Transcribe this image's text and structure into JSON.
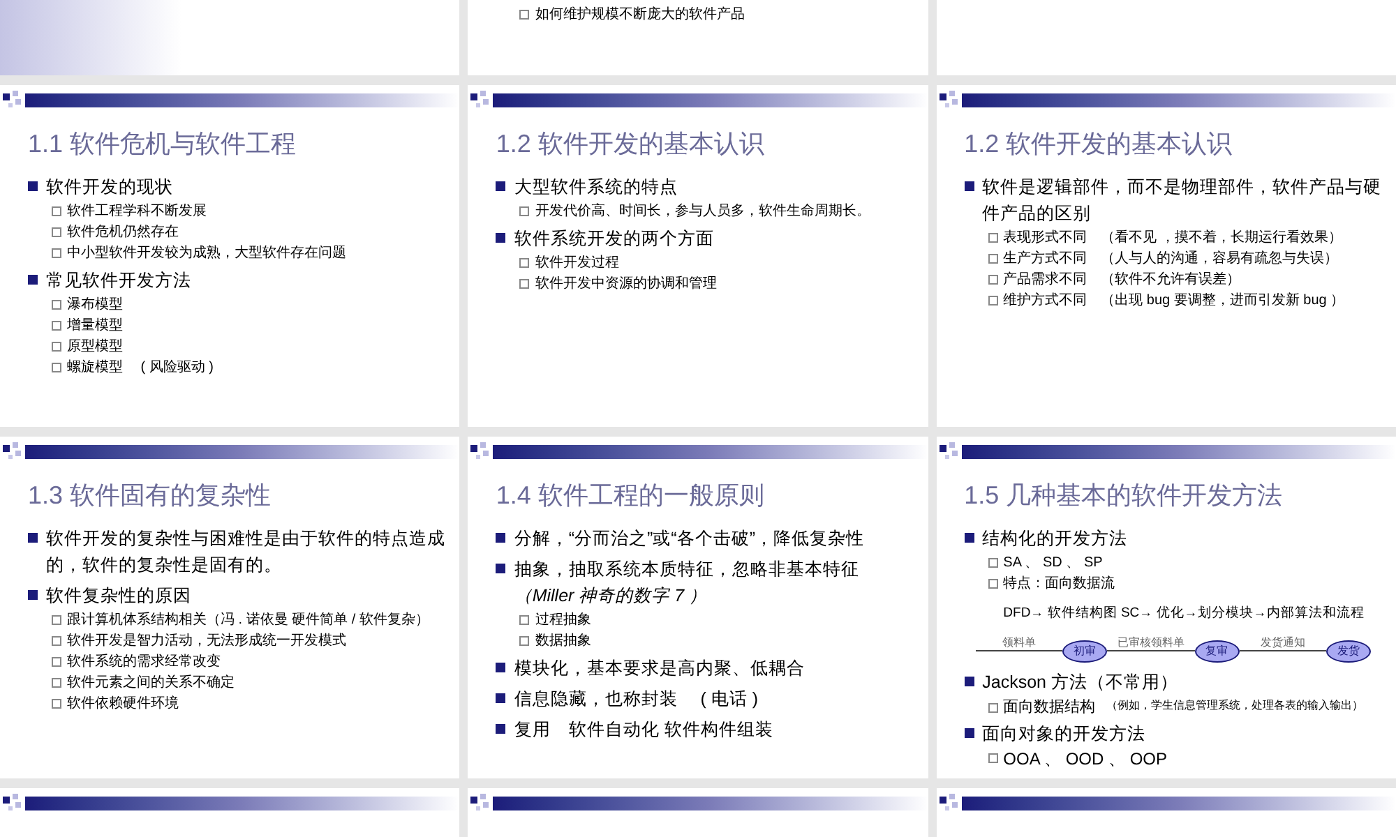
{
  "slides": [
    {
      "kind": "cut_top",
      "shaded": true
    },
    {
      "kind": "cut_top",
      "items": [
        {
          "kind": "sub",
          "text": "如何维护规模不断庞大的软件产品"
        }
      ]
    },
    {
      "kind": "cut_top"
    },
    {
      "kind": "full",
      "title": "1.1  软件危机与软件工程",
      "items": [
        {
          "kind": "bullet",
          "text": "软件开发的现状"
        },
        {
          "kind": "sub",
          "text": "软件工程学科不断发展"
        },
        {
          "kind": "sub",
          "text": "软件危机仍然存在"
        },
        {
          "kind": "sub",
          "text": "中小型软件开发较为成熟，大型软件存在问题"
        },
        {
          "kind": "bullet",
          "text": "常见软件开发方法"
        },
        {
          "kind": "sub",
          "text": "瀑布模型"
        },
        {
          "kind": "sub",
          "text": "增量模型"
        },
        {
          "kind": "sub",
          "text": "原型模型"
        },
        {
          "kind": "sub",
          "text": "螺旋模型　 ( 风险驱动 )"
        }
      ]
    },
    {
      "kind": "full",
      "title": "1.2  软件开发的基本认识",
      "items": [
        {
          "kind": "bullet",
          "text": "大型软件系统的特点"
        },
        {
          "kind": "sub",
          "text": "开发代价高、时间长，参与人员多，软件生命周期长。"
        },
        {
          "kind": "bullet",
          "text": "软件系统开发的两个方面"
        },
        {
          "kind": "sub",
          "text": "软件开发过程"
        },
        {
          "kind": "sub",
          "text": "软件开发中资源的协调和管理"
        }
      ]
    },
    {
      "kind": "full",
      "title": "1.2  软件开发的基本认识",
      "items": [
        {
          "kind": "bullet",
          "text": "软件是逻辑部件，而不是物理部件，软件产品与硬件产品的区别"
        },
        {
          "kind": "sub",
          "text": "表现形式不同　（看不见 ，摸不着，长期运行看效果）"
        },
        {
          "kind": "sub",
          "text": "生产方式不同　（人与人的沟通，容易有疏忽与失误）"
        },
        {
          "kind": "sub",
          "text": "产品需求不同　（软件不允许有误差）"
        },
        {
          "kind": "sub",
          "text": "维护方式不同　（出现 bug 要调整，进而引发新 bug ）"
        }
      ]
    },
    {
      "kind": "full",
      "title": "1.3  软件固有的复杂性",
      "items": [
        {
          "kind": "bullet",
          "text": "软件开发的复杂性与困难性是由于软件的特点造成的，软件的复杂性是固有的。"
        },
        {
          "kind": "bullet",
          "text": "软件复杂性的原因"
        },
        {
          "kind": "sub",
          "text": "跟计算机体系结构相关（冯 . 诺依曼  硬件简单 / 软件复杂）"
        },
        {
          "kind": "sub",
          "text": "软件开发是智力活动，无法形成统一开发模式"
        },
        {
          "kind": "sub",
          "text": "软件系统的需求经常改变"
        },
        {
          "kind": "sub",
          "text": "软件元素之间的关系不确定"
        },
        {
          "kind": "sub",
          "text": "软件依赖硬件环境"
        }
      ]
    },
    {
      "kind": "full",
      "title": "1.4  软件工程的一般原则",
      "items": [
        {
          "kind": "bullet",
          "text": "分解，“分而治之”或“各个击破”，降低复杂性"
        },
        {
          "kind": "bullet",
          "text": "抽象，抽取系统本质特征，忽略非基本特征",
          "aside": "（Miller 神奇的数字 7 ）"
        },
        {
          "kind": "sub",
          "text": "过程抽象"
        },
        {
          "kind": "sub",
          "text": "数据抽象"
        },
        {
          "kind": "bullet",
          "text": "模块化，基本要求是高内聚、低耦合"
        },
        {
          "kind": "bullet",
          "text": "信息隐藏，也称封装　 ( 电话 )"
        },
        {
          "kind": "bullet",
          "text": "复用　软件自动化  软件构件组装"
        }
      ]
    },
    {
      "kind": "full",
      "title": "1.5  几种基本的软件开发方法",
      "items": [
        {
          "kind": "bullet",
          "text": "结构化的开发方法"
        },
        {
          "kind": "sub",
          "text": "SA 、 SD 、 SP"
        },
        {
          "kind": "sub",
          "text": "特点：面向数据流"
        },
        {
          "kind": "line",
          "text": "DFD→ 软件结构图 SC→ 优化→划分模块→内部算法和流程"
        },
        {
          "kind": "flow",
          "steps": [
            {
              "label": "领料单",
              "node": "初审"
            },
            {
              "label": "已审核领料单",
              "node": "复审"
            },
            {
              "label": "发货通知",
              "node": "发货"
            }
          ]
        },
        {
          "kind": "bullet",
          "text": "Jackson 方法（不常用）"
        },
        {
          "kind": "sub_note",
          "text": "面向数据结构",
          "note": "（例如，学生信息管理系统，处理各表的输入输出）"
        },
        {
          "kind": "bullet",
          "text": "面向对象的开发方法"
        },
        {
          "kind": "sub_large",
          "text": "OOA 、 OOD 、 OOP"
        }
      ]
    },
    {
      "kind": "cut_bottom"
    },
    {
      "kind": "cut_bottom"
    },
    {
      "kind": "cut_bottom"
    }
  ]
}
